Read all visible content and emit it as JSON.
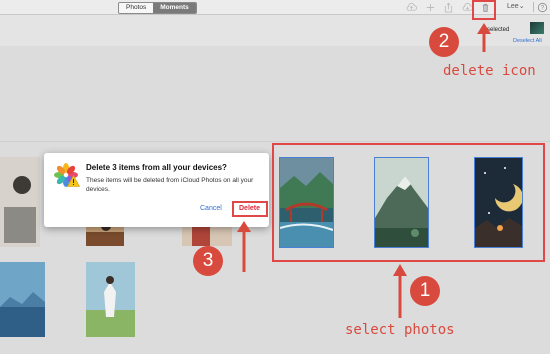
{
  "toolbar": {
    "tabs": [
      {
        "label": "Photos",
        "active": false
      },
      {
        "label": "Moments",
        "active": true
      }
    ],
    "icons": [
      "upload-icon",
      "add-icon",
      "share-icon",
      "download-icon",
      "trash-icon"
    ],
    "user": "Lee",
    "help_icon": "help-icon"
  },
  "selection": {
    "count_text": "3 selected",
    "deselect_label": "Deselect All"
  },
  "dialog": {
    "title": "Delete 3 items from all your devices?",
    "body": "These items will be deleted from iCloud Photos on all your devices.",
    "cancel_label": "Cancel",
    "delete_label": "Delete",
    "icon": "photos-app-icon"
  },
  "annotations": {
    "step1_number": "1",
    "step1_label": "select photos",
    "step2_number": "2",
    "step2_label": "delete icon",
    "step3_number": "3"
  },
  "colors": {
    "annotation_red": "#d94a3e",
    "selection_blue": "#4a7fd6",
    "link_blue": "#2f6fd6",
    "delete_red": "#e0283a"
  }
}
